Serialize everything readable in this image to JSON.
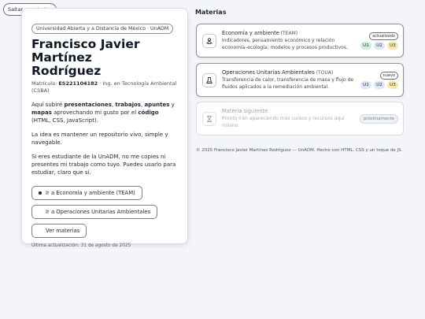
{
  "skip_link": "Saltar a materias",
  "profile": {
    "institution": "Universidad Abierta y a Distancia de México · UnADM",
    "name_line1": "Francisco Javier Martínez",
    "name_line2": "Rodríguez",
    "matricula_label": "Matrícula: ",
    "matricula": "ES221104182",
    "program": " · Ing. en Tecnología Ambiental (CSBA)",
    "para1": {
      "t1": "Aquí subiré ",
      "b1": "presentaciones",
      "t2": ", ",
      "b2": "trabajos",
      "t3": ", ",
      "b3": "apuntes",
      "t4": " y ",
      "b4": "mapas",
      "t5": " aprovechando mi gusto por el ",
      "b5": "código",
      "t6": " (HTML, CSS, JavaScript)."
    },
    "para2": "La idea es mantener un repositorio vivo, simple y navegable.",
    "para3": "Si eres estudiante de la UnADM, no me copies ni presentes mi trabajo como tuyo. Puedes usarlo para estudiar, claro que sí.",
    "buttons": {
      "team": "Ir a Economía y ambiente (TEAM)",
      "toua": "Ir a Operaciones Unitarias Ambientales",
      "all": "Ver materias"
    },
    "updated": "Última actualización: 31 de agosto de 2025"
  },
  "materias": {
    "title": "Materias",
    "cards": [
      {
        "title": "Economía y ambiente",
        "abbr": " (TEAM)",
        "desc": "Indicadores, pensamiento económico y relación economía–ecología; modelos y procesos productivos.",
        "badge": "actualizado",
        "units": [
          "U1",
          "U2",
          "U3"
        ],
        "icon": "recycle-people-icon"
      },
      {
        "title": "Operaciones Unitarias Ambientales",
        "abbr": " (TOUA)",
        "desc": "Transferencia de calor, transferencia de masa y flujo de fluidos aplicados a la remediación ambiental.",
        "badge": "nuevo",
        "units": [
          "U1",
          "U2",
          "U3"
        ],
        "icon": "flask-icon"
      },
      {
        "title": "Materia siguiente",
        "desc": "Pronto irán apareciendo más cursos y recursos aquí mismo.",
        "badge": "próximamente",
        "icon": "hourglass-icon"
      }
    ]
  },
  "footer": "© 2025 Francisco Javier Martínez Rodríguez — UnADM. Hecho con HTML, CSS y un toque de JS.",
  "colors": {
    "u1": "#cdeed7",
    "u2": "#dbe6f6",
    "u3": "#f8e9a8"
  }
}
